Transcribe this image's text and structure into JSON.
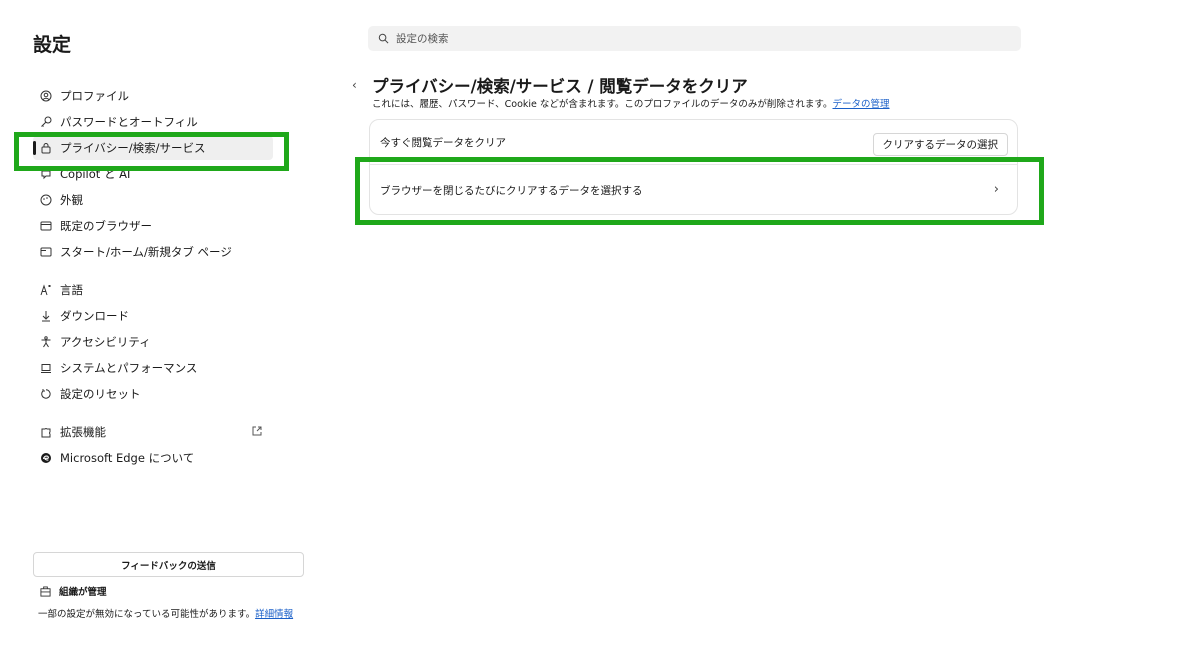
{
  "sidebar": {
    "title": "設定",
    "items": [
      {
        "label": "プロファイル",
        "icon": "profile-icon"
      },
      {
        "label": "パスワードとオートフィル",
        "icon": "key-icon"
      },
      {
        "label": "プライバシー/検索/サービス",
        "icon": "lock-icon"
      },
      {
        "label": "Copilot と AI",
        "icon": "copilot-icon"
      },
      {
        "label": "外観",
        "icon": "appearance-icon"
      },
      {
        "label": "既定のブラウザー",
        "icon": "browser-icon"
      },
      {
        "label": "スタート/ホーム/新規タブ ページ",
        "icon": "newtab-icon"
      },
      {
        "label": "言語",
        "icon": "language-icon"
      },
      {
        "label": "ダウンロード",
        "icon": "download-icon"
      },
      {
        "label": "アクセシビリティ",
        "icon": "accessibility-icon"
      },
      {
        "label": "システムとパフォーマンス",
        "icon": "laptop-icon"
      },
      {
        "label": "設定のリセット",
        "icon": "reset-icon"
      },
      {
        "label": "拡張機能",
        "icon": "puzzle-icon"
      },
      {
        "label": "Microsoft Edge について",
        "icon": "edge-icon"
      }
    ],
    "feedback_label": "フィードバックの送信",
    "managed_label": "組織が管理",
    "managed_note": "一部の設定が無効になっている可能性があります。",
    "managed_link": "詳細情報"
  },
  "search": {
    "placeholder": "設定の検索"
  },
  "main": {
    "title": "プライバシー/検索/サービス / 閲覧データをクリア",
    "description": "これには、履歴、パスワード、Cookie などが含まれます。このプロファイルのデータのみが削除されます。",
    "description_link": "データの管理",
    "row1_label": "今すぐ閲覧データをクリア",
    "row1_button": "クリアするデータの選択",
    "row2_label": "ブラウザーを閉じるたびにクリアするデータを選択する"
  },
  "colors": {
    "highlight": "#1fa81a",
    "link": "#1a5fc8"
  }
}
